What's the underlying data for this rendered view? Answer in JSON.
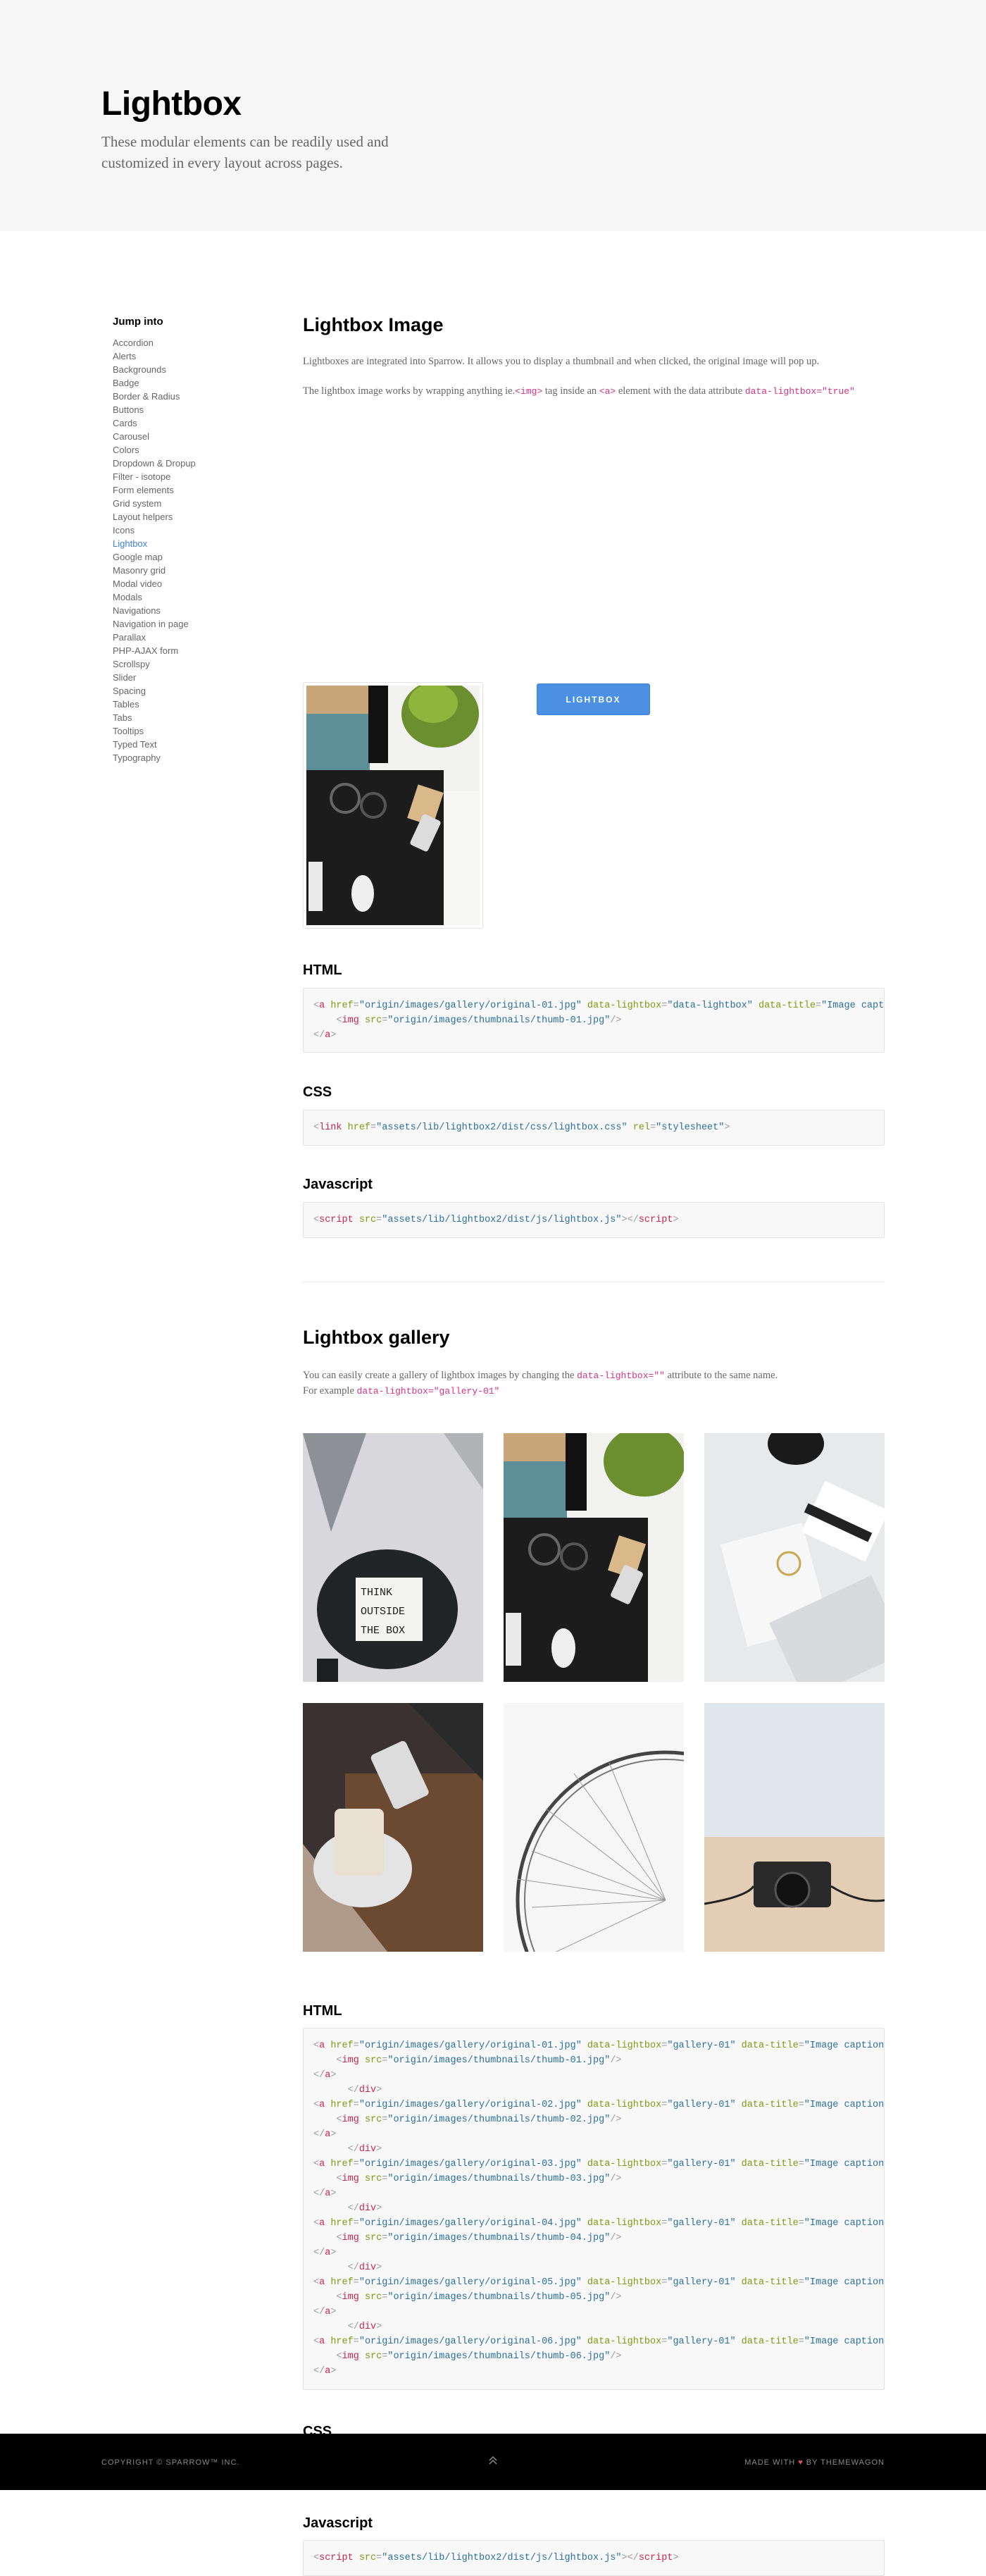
{
  "hero": {
    "title": "Lightbox",
    "subtitle": "These modular elements can be readily used and customized in every layout across pages."
  },
  "sidebar": {
    "heading": "Jump into",
    "items": [
      "Accordion",
      "Alerts",
      "Backgrounds",
      "Badge",
      "Border & Radius",
      "Buttons",
      "Cards",
      "Carousel",
      "Colors",
      "Dropdown & Dropup",
      "Filter - isotope",
      "Form elements",
      "Grid system",
      "Layout helpers",
      "Icons",
      "Lightbox",
      "Google map",
      "Masonry grid",
      "Modal video",
      "Modals",
      "Navigations",
      "Navigation in page",
      "Parallax",
      "PHP-AJAX form",
      "Scrollspy",
      "Slider",
      "Spacing",
      "Tables",
      "Tabs",
      "Tooltips",
      "Typed Text",
      "Typography"
    ],
    "active": "Lightbox"
  },
  "lightbox_image": {
    "title": "Lightbox Image",
    "para1": "Lightboxes are integrated into Sparrow. It allows you to display a thumbnail and when clicked, the original image will pop up.",
    "para2_a": "The lightbox image works by wrapping anything ie.",
    "para2_code1": "<img>",
    "para2_b": " tag inside an ",
    "para2_code2": "<a>",
    "para2_c": " element with the data attribute ",
    "para2_code3": "data-lightbox=\"true\"",
    "button_label": "LIGHTBOX",
    "html_label": "HTML",
    "css_label": "CSS",
    "js_label": "Javascript"
  },
  "code": {
    "img_href": "\"origin/images/gallery/original-01.jpg\"",
    "img_lb": "\"data-lightbox\"",
    "title_val": "\"Image caption\"",
    "img_src": "\"origin/images/thumbnails/thumb-01.jpg\"",
    "css_href": "\"assets/lib/lightbox2/dist/css/lightbox.css\"",
    "css_rel": "\"stylesheet\"",
    "js_src": "\"assets/lib/lightbox2/dist/js/lightbox.js\"",
    "gal_lb": "\"gallery-01\"",
    "g1_href": "\"origin/images/gallery/original-01.jpg\"",
    "g1_src": "\"origin/images/thumbnails/thumb-01.jpg\"",
    "g2_href": "\"origin/images/gallery/original-02.jpg\"",
    "g2_src": "\"origin/images/thumbnails/thumb-02.jpg\"",
    "g3_href": "\"origin/images/gallery/original-03.jpg\"",
    "g3_src": "\"origin/images/thumbnails/thumb-03.jpg\"",
    "g4_href": "\"origin/images/gallery/original-04.jpg\"",
    "g4_src": "\"origin/images/thumbnails/thumb-04.jpg\"",
    "g5_href": "\"origin/images/gallery/original-05.jpg\"",
    "g5_src": "\"origin/images/thumbnails/thumb-05.jpg\"",
    "g6_href": "\"origin/images/gallery/original-06.jpg\"",
    "g6_src": "\"origin/images/thumbnails/thumb-06.jpg\""
  },
  "gallery": {
    "title": "Lightbox gallery",
    "para1_a": "You can easily create a gallery of lightbox images by changing the ",
    "para1_code": "data-lightbox=\"\"",
    "para1_b": " attribute to the same name.",
    "para2_a": "For example ",
    "para2_code": "data-lightbox=\"gallery-01\"",
    "html_label": "HTML",
    "css_label": "CSS",
    "js_label": "Javascript"
  },
  "footer": {
    "copyright": "COPYRIGHT © SPARROW™ INC.",
    "made_a": "MADE WITH ",
    "heart": "♥",
    "made_b": " BY THEMEWAGON"
  }
}
